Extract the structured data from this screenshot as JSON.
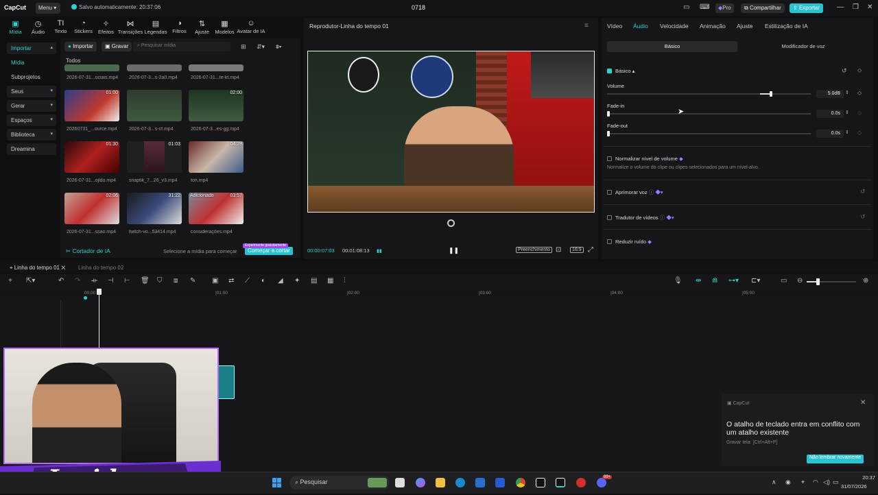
{
  "titlebar": {
    "logo": "CapCut",
    "menu_label": "Menu",
    "autosave": "Salvo automaticamente: 20:37:06",
    "project_title": "0718",
    "pro_label": "Pro",
    "share_label": "Compartilhar",
    "export_label": "Exportar"
  },
  "toolbar": {
    "items": [
      "Mídia",
      "Áudio",
      "Texto",
      "Stickers",
      "Efeitos",
      "Transições",
      "Legendas",
      "Filtros",
      "Ajuste",
      "Modelos",
      "Avatar de IA"
    ]
  },
  "leftnav": {
    "items": [
      "Importar",
      "Mídia",
      "Subprojetos",
      "Seus",
      "Gerar",
      "Espaços",
      "Biblioteca",
      "Dreamina"
    ]
  },
  "media": {
    "import_label": "Importar",
    "record_label": "Gravar",
    "search_placeholder": "Pesquisar mídia",
    "filter_all": "Todos",
    "top_captions": [
      "2026-07-31...ociais.mp4",
      "2026-07-3...s-2a0.mp4",
      "2026-07-31...te-kt.mp4"
    ],
    "items": [
      {
        "caption": "20260731_...ource.mp4",
        "duration": "01:00",
        "added": ""
      },
      {
        "caption": "2026-07-3...s-cf.mp4",
        "duration": "",
        "added": ""
      },
      {
        "caption": "2026-07-3...es-gg.mp4",
        "duration": "02:00",
        "added": ""
      },
      {
        "caption": "2026-07-31...ojldo.mp4",
        "duration": "01:30",
        "added": ""
      },
      {
        "caption": "snaptik_7...26_v3.mp4",
        "duration": "01:03",
        "added": ""
      },
      {
        "caption": "ton.mp4",
        "duration": "04:28",
        "added": ""
      },
      {
        "caption": "2026-07-31...ssao.mp4",
        "duration": "02:06",
        "added": ""
      },
      {
        "caption": "twitch-vo...53414.mp4",
        "duration": "31:22",
        "added": ""
      },
      {
        "caption": "considerações.mp4",
        "duration": "03:57",
        "added": "Adicionado"
      }
    ],
    "ai_cutter": "Cortador de IA",
    "select_hint": "Selecione a mídia para começar",
    "start_cut": "Começar a cortar",
    "free_trial": "Experimente gratuitamente"
  },
  "player": {
    "title": "Reprodutor-Linha do tempo 01",
    "time_current": "00:00:07:03",
    "time_total": "00:01:08:13",
    "fill_label": "Preenchimento",
    "ratio_label": "16:9"
  },
  "right": {
    "tabs": [
      "Vídeo",
      "Áudio",
      "Velocidade",
      "Animação",
      "Ajuste",
      "Estilização de IA"
    ],
    "active_tab": "Áudio",
    "subtab_basic": "Básico",
    "subtab_voice": "Modificador de voz",
    "section_basic": "Básico",
    "volume_label": "Volume",
    "volume_value": "5.0dB",
    "volume_level": 0.88,
    "fadein_label": "Fade-in",
    "fadein_value": "0.0s",
    "fadeout_label": "Fade-out",
    "fadeout_value": "0.0s",
    "normalize_label": "Normalizar nível de volume",
    "normalize_desc": "Normalize o volume do clipe ou clipes selecionados para um nível-alvo.",
    "enhance_label": "Aprimorar voz",
    "translator_label": "Tradutor de vídeos",
    "reduce_noise_label": "Reduzir ruído"
  },
  "timeline": {
    "tab1": "Linha do tempo 01",
    "tab2": "Linha do tempo 02",
    "ruler": [
      "00:00",
      "|01:00",
      "|02:00",
      "|03:00",
      "|04:00",
      "|05:00"
    ]
  },
  "notification": {
    "app": "CapCut",
    "message": "O atalho de teclado entra em conflito com um atalho existente",
    "hint": "Gravar tela: [Ctrl+Alt+P]",
    "button": "Não lembrar novamente"
  },
  "taskbar": {
    "search": "Pesquisar",
    "time": "20:37",
    "date": "31/07/2026",
    "badge": "99+"
  },
  "overlay": {
    "banner_text": "Insider"
  }
}
